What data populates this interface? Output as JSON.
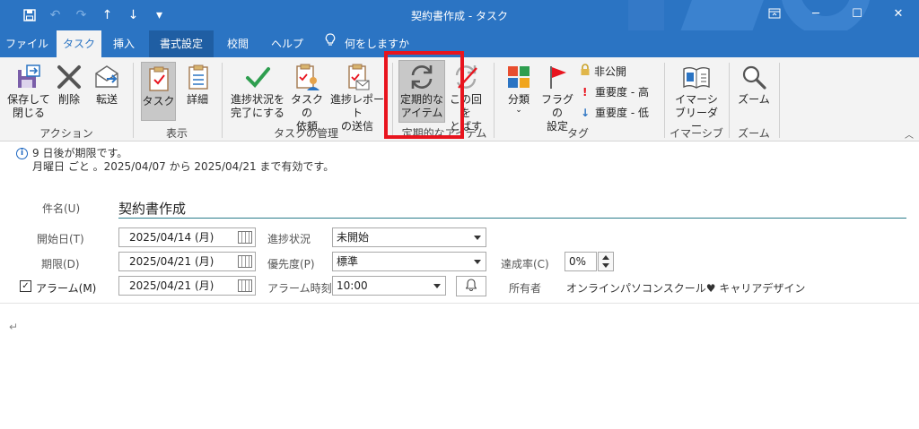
{
  "window": {
    "title": "契約書作成 - タスク",
    "qat": {
      "save": "💾",
      "undo": "↶",
      "redo": "↷",
      "up": "↑",
      "down": "↓",
      "more": "▾"
    },
    "controls": {
      "ribbon_display": "⧉",
      "minimize": "─",
      "maximize": "☐",
      "close": "✕"
    }
  },
  "tabs": {
    "file": "ファイル",
    "task": "タスク",
    "insert": "挿入",
    "format": "書式設定",
    "review": "校閲",
    "help": "ヘルプ",
    "tellme": "何をしますか"
  },
  "ribbon": {
    "actions": {
      "save_close": "保存して\n閉じる",
      "delete": "削除",
      "forward": "転送",
      "group": "アクション"
    },
    "show": {
      "task": "タスク",
      "details": "詳細",
      "group": "表示"
    },
    "manage": {
      "mark_complete": "進捗状況を\n完了にする",
      "assign": "タスクの\n依頼",
      "send_report": "進捗レポート\nの送信",
      "group": "タスクの管理"
    },
    "recurrence": {
      "recurrence": "定期的な\nアイテム",
      "skip": "この回を\nとばす",
      "group": "定期的なアイテム"
    },
    "tags": {
      "categorize": "分類",
      "followup": "フラグの\n設定",
      "private": "非公開",
      "high": "重要度 - 高",
      "low": "重要度 - 低",
      "group": "タグ"
    },
    "immersive": {
      "reader": "イマーシ\nブリーダー",
      "group": "イマーシブ"
    },
    "zoom": {
      "zoom": "ズーム",
      "group": "ズーム"
    }
  },
  "info": {
    "line1": "9 日後が期限です。",
    "line2": "月曜日 ごと 。2025/04/07 から 2025/04/21 まで有効です。"
  },
  "form": {
    "subject_label": "件名(U)",
    "subject_value": "契約書作成",
    "start_label": "開始日(T)",
    "start_value": "2025/04/14 (月)",
    "due_label": "期限(D)",
    "due_value": "2025/04/21 (月)",
    "reminder_label": "アラーム(M)",
    "reminder_date": "2025/04/21 (月)",
    "reminder_checked": "✓",
    "status_label": "進捗状況",
    "status_value": "未開始",
    "priority_label": "優先度(P)",
    "priority_value": "標準",
    "alarm_time_label": "アラーム時刻",
    "alarm_time_value": "10:00",
    "complete_label": "達成率(C)",
    "complete_value": "0%",
    "owner_label": "所有者",
    "owner_value": "オンラインパソコンスクール♥ キャリアデザイン"
  },
  "body": {
    "paragraph_mark": "↵"
  },
  "colors": {
    "accent": "#2b74c3",
    "highlight": "#e8141e",
    "check": "#2e9e4f"
  }
}
